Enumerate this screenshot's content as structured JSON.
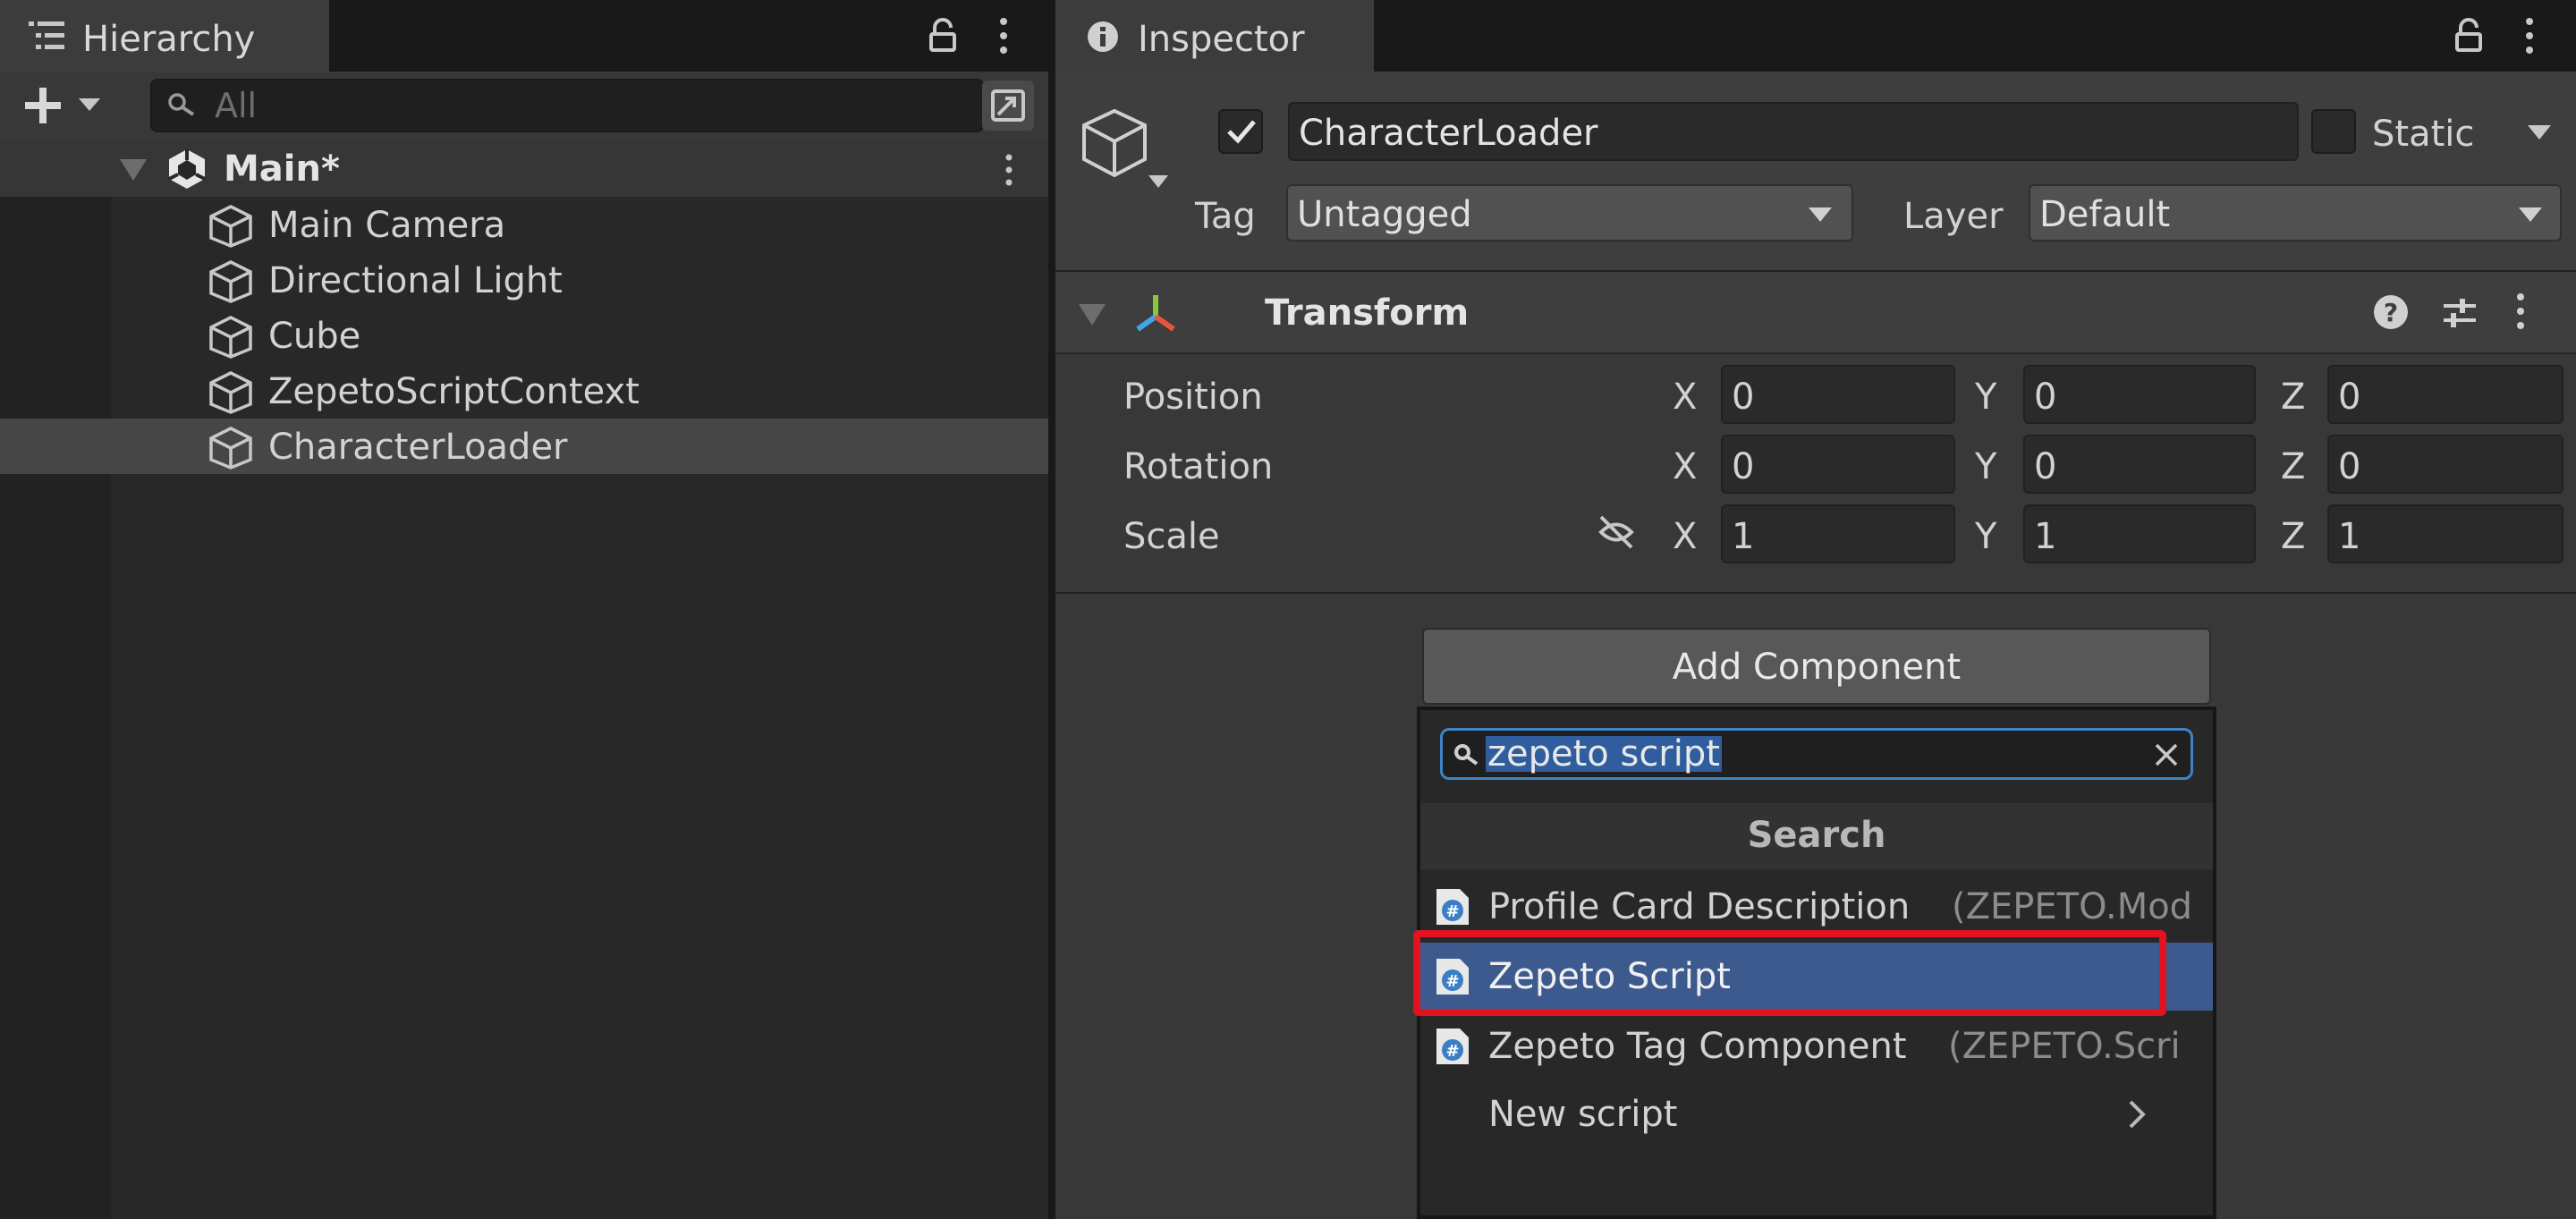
{
  "hierarchy": {
    "tab_label": "Hierarchy",
    "search_placeholder": "All",
    "scene_name": "Main*",
    "items": [
      {
        "label": "Main Camera"
      },
      {
        "label": "Directional Light"
      },
      {
        "label": "Cube"
      },
      {
        "label": "ZepetoScriptContext"
      },
      {
        "label": "CharacterLoader",
        "selected": true
      }
    ]
  },
  "inspector": {
    "tab_label": "Inspector",
    "object_name": "CharacterLoader",
    "active_checked": true,
    "static_label": "Static",
    "tag_label": "Tag",
    "tag_value": "Untagged",
    "layer_label": "Layer",
    "layer_value": "Default",
    "transform": {
      "title": "Transform",
      "rows": [
        {
          "label": "Position",
          "x": "0",
          "y": "0",
          "z": "0"
        },
        {
          "label": "Rotation",
          "x": "0",
          "y": "0",
          "z": "0"
        },
        {
          "label": "Scale",
          "x": "1",
          "y": "1",
          "z": "1"
        }
      ],
      "axis_x": "X",
      "axis_y": "Y",
      "axis_z": "Z"
    },
    "add_component": {
      "button_label": "Add Component",
      "search_value": "zepeto script",
      "section_title": "Search",
      "results": [
        {
          "label": "Profile Card Description",
          "namespace": "(ZEPETO.Mod"
        },
        {
          "label": "Zepeto Script",
          "namespace": "",
          "selected": true
        },
        {
          "label": "Zepeto Tag Component",
          "namespace": "(ZEPETO.Scri"
        },
        {
          "label": "New script",
          "namespace": ""
        }
      ]
    }
  },
  "colors": {
    "selection_blue": "#3d5a8e",
    "highlight_red": "#e0131f",
    "search_focus": "#3d84c6"
  },
  "icons": [
    "list-icon",
    "lock-icon",
    "kebab-icon",
    "plus-icon",
    "chevron-down-icon",
    "search-icon",
    "focus-icon",
    "unity-icon",
    "cube-icon",
    "info-icon",
    "checkmark-icon",
    "transform-icon",
    "help-icon",
    "preset-icon",
    "unlink-icon",
    "close-icon",
    "csharp-script-icon",
    "chevron-right-icon"
  ]
}
